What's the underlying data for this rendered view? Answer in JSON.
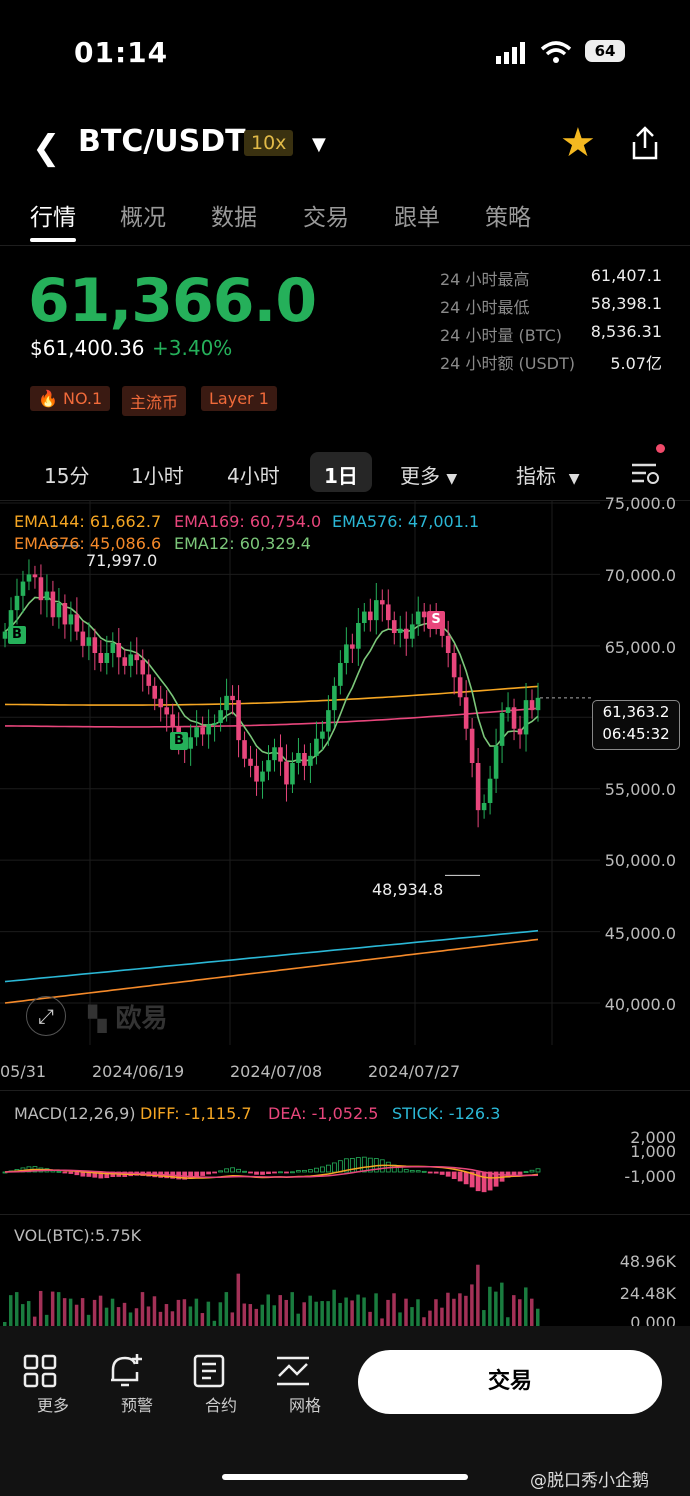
{
  "status_bar": {
    "time": "01:14",
    "battery": "64"
  },
  "header": {
    "pair": "BTC/USDT",
    "leverage": "10x",
    "star_icon": "star-icon",
    "share_icon": "share-icon"
  },
  "tabs": [
    {
      "label": "行情"
    },
    {
      "label": "概况"
    },
    {
      "label": "数据"
    },
    {
      "label": "交易"
    },
    {
      "label": "跟单"
    },
    {
      "label": "策略"
    }
  ],
  "price": {
    "last": "61,366.0",
    "usd": "$61,400.36",
    "change": "+3.40%"
  },
  "stats": [
    {
      "label": "24 小时最高",
      "value": "61,407.1"
    },
    {
      "label": "24 小时最低",
      "value": "58,398.1"
    },
    {
      "label": "24 小时量 (BTC)",
      "value": "8,536.31"
    },
    {
      "label": "24 小时额 (USDT)",
      "value": "5.07亿"
    }
  ],
  "tags": [
    {
      "label": "NO.1"
    },
    {
      "label": "主流币"
    },
    {
      "label": "Layer 1"
    }
  ],
  "intervals": {
    "items": [
      "15分",
      "1小时",
      "4小时",
      "1日"
    ],
    "more": "更多",
    "indicator": "指标"
  },
  "colors": {
    "up": "#25b05a",
    "down": "#e8467c",
    "accent": "#f4b820"
  },
  "chart_data": {
    "type": "candlestick",
    "ema": [
      {
        "name": "EMA144",
        "value": "61,662.7",
        "color": "#f5a623"
      },
      {
        "name": "EMA169",
        "value": "60,754.0",
        "color": "#e8467c"
      },
      {
        "name": "EMA576",
        "value": "47,001.1",
        "color": "#2bb8d6"
      },
      {
        "name": "EMA676",
        "value": "45,086.6",
        "color": "#f58a2a"
      },
      {
        "name": "EMA12",
        "value": "60,329.4",
        "color": "#7cc77a"
      }
    ],
    "y_ticks": [
      "75,000.0",
      "70,000.0",
      "65,000.0",
      "55,000.0",
      "50,000.0",
      "45,000.0",
      "40,000.0"
    ],
    "ylim": [
      40000,
      75000
    ],
    "x_ticks": [
      "05/31",
      "2024/06/19",
      "2024/07/08",
      "2024/07/27"
    ],
    "high_marker": "71,997.0",
    "low_marker": "48,934.8",
    "current_price": "61,363.2",
    "countdown": "06:45:32",
    "signals": [
      {
        "label": "B"
      },
      {
        "label": "B"
      },
      {
        "label": "S"
      }
    ],
    "close": [
      66000,
      67500,
      68500,
      69500,
      70000,
      69800,
      68200,
      68800,
      67000,
      68000,
      66500,
      67200,
      66000,
      65000,
      65600,
      64500,
      63800,
      64500,
      65200,
      64200,
      63600,
      64400,
      64000,
      63000,
      62200,
      61300,
      60700,
      60200,
      59300,
      58200,
      57800,
      58600,
      59300,
      58800,
      59500,
      59600,
      60500,
      61500,
      61200,
      58400,
      57100,
      56600,
      55500,
      56200,
      57000,
      57900,
      56900,
      55300,
      56800,
      57500,
      56600,
      57300,
      58500,
      59000,
      60500,
      62200,
      63800,
      65100,
      64800,
      66600,
      67400,
      66800,
      68200,
      67900,
      66800,
      65900,
      66200,
      65500,
      66500,
      67400,
      67000,
      66800,
      66400,
      65700,
      64500,
      62800,
      61400,
      59200,
      56800,
      53500,
      54000,
      55700,
      58000,
      60300,
      60700,
      59200,
      58800,
      61200,
      60500,
      61363
    ]
  },
  "macd": {
    "title": "MACD(12,26,9)",
    "diff": "DIFF: -1,115.7",
    "dea": "DEA: -1,052.5",
    "stick": "STICK: -126.3",
    "ticks": [
      "2,000",
      "1,000",
      "-1,000"
    ]
  },
  "volume": {
    "title": "VOL(BTC):5.75K",
    "ticks": [
      "48.96K",
      "24.48K",
      "0.000"
    ]
  },
  "logo_text": "欧易",
  "bottom_nav": [
    {
      "label": "更多",
      "icon": "grid-icon"
    },
    {
      "label": "预警",
      "icon": "bell-plus-icon"
    },
    {
      "label": "合约",
      "icon": "document-icon"
    },
    {
      "label": "网格",
      "icon": "grid-chart-icon"
    }
  ],
  "trade_button": "交易",
  "watermark": "@脱口秀小企鹅"
}
